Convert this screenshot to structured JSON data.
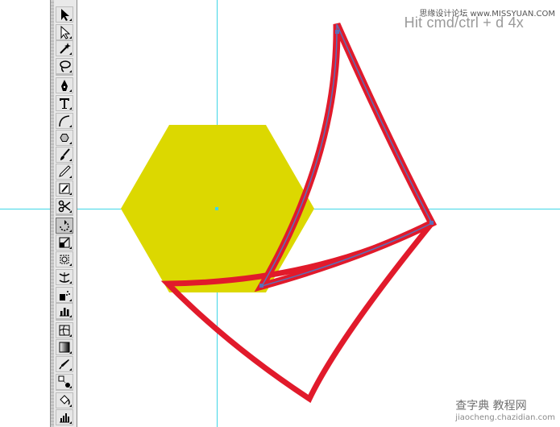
{
  "hint": {
    "text": "Hit cmd/ctrl + d 4x"
  },
  "watermark": {
    "top": "思缘设计论坛 www.MISSYUAN.COM",
    "bottom": "查字典 教程网",
    "bottom_url": "jiaocheng.chazidian.com"
  },
  "colors": {
    "hexagon": "#dcd800",
    "stroke": "#e11a2b",
    "guide": "#3fd6e6",
    "path_highlight": "#5b6fb7"
  },
  "toolbar": {
    "tools": [
      {
        "name": "selection-tool",
        "icon": "arrow-icon",
        "active": false
      },
      {
        "name": "direct-selection-tool",
        "icon": "white-arrow-icon",
        "active": false
      },
      {
        "name": "magic-wand-tool",
        "icon": "magic-wand-icon",
        "active": false
      },
      {
        "name": "lasso-tool",
        "icon": "lasso-icon",
        "active": false
      },
      {
        "name": "pen-tool",
        "icon": "pen-icon",
        "active": false
      },
      {
        "name": "type-tool",
        "icon": "type-icon",
        "active": false
      },
      {
        "name": "arc-tool",
        "icon": "arc-icon",
        "active": false
      },
      {
        "name": "polygon-tool",
        "icon": "hexagon-icon",
        "active": false
      },
      {
        "name": "paintbrush-tool",
        "icon": "brush-icon",
        "active": false
      },
      {
        "name": "pencil-tool",
        "icon": "pencil-icon",
        "active": false
      },
      {
        "name": "blob-brush-tool",
        "icon": "blob-icon",
        "active": false
      },
      {
        "name": "scissors-tool",
        "icon": "scissors-icon",
        "active": false
      },
      {
        "name": "rotate-tool",
        "icon": "rotate-icon",
        "active": true
      },
      {
        "name": "scale-tool",
        "icon": "scale-icon",
        "active": false
      },
      {
        "name": "free-transform-tool",
        "icon": "transform-icon",
        "active": false
      },
      {
        "name": "warp-tool",
        "icon": "warp-icon",
        "active": false
      },
      {
        "name": "symbol-sprayer-tool",
        "icon": "sprayer-icon",
        "active": false
      },
      {
        "name": "column-graph-tool",
        "icon": "column-graph-icon",
        "active": false
      },
      {
        "name": "mesh-tool",
        "icon": "mesh-icon",
        "active": false
      },
      {
        "name": "gradient-tool",
        "icon": "gradient-icon",
        "active": false
      },
      {
        "name": "eyedropper-tool",
        "icon": "eyedropper-icon",
        "active": false
      },
      {
        "name": "blend-tool",
        "icon": "blend-icon",
        "active": false
      },
      {
        "name": "live-paint-tool",
        "icon": "paint-bucket-icon",
        "active": false
      },
      {
        "name": "graph-tool",
        "icon": "bar-graph-icon",
        "active": false
      }
    ]
  }
}
